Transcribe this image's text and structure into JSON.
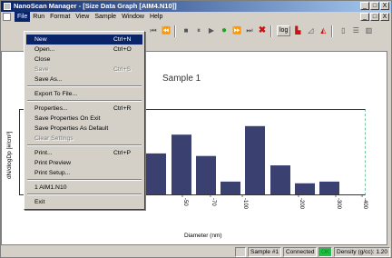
{
  "window": {
    "title": "NanoScan Manager - [Size Data Graph  [AIM4.N10]]",
    "minimize": "_",
    "maximize": "□",
    "close": "X"
  },
  "mdi": {
    "minimize": "_",
    "restore": "□",
    "close": "X"
  },
  "menubar": {
    "items": [
      "File",
      "Run",
      "Format",
      "View",
      "Sample",
      "Window",
      "Help"
    ]
  },
  "toolbar": {
    "log_label": "log"
  },
  "file_menu": {
    "items": [
      {
        "label": "New",
        "shortcut": "Ctrl+N"
      },
      {
        "label": "Open...",
        "shortcut": "Ctrl+O"
      },
      {
        "label": "Close",
        "shortcut": ""
      },
      {
        "label": "Save",
        "shortcut": "Ctrl+S"
      },
      {
        "label": "Save As...",
        "shortcut": ""
      },
      {
        "label": "Export To File...",
        "shortcut": ""
      },
      {
        "label": "Properties...",
        "shortcut": "Ctrl+R"
      },
      {
        "label": "Save Properties On Exit",
        "shortcut": ""
      },
      {
        "label": "Save Properties As Default",
        "shortcut": ""
      },
      {
        "label": "Clear Settings",
        "shortcut": ""
      },
      {
        "label": "Print...",
        "shortcut": "Ctrl+P"
      },
      {
        "label": "Print Preview",
        "shortcut": ""
      },
      {
        "label": "Print Setup...",
        "shortcut": ""
      },
      {
        "label": "1 AIM1.N10",
        "shortcut": ""
      },
      {
        "label": "Exit",
        "shortcut": ""
      }
    ]
  },
  "chart_data": {
    "type": "bar",
    "title": "Sample 1",
    "xlabel": "Diameter (nm)",
    "ylabel": "dN/dlogDp [#/cm³]",
    "tick_labels": [
      "50",
      "70",
      "100",
      "200",
      "300",
      "400"
    ],
    "values": [
      48,
      70,
      45,
      15,
      80,
      34,
      13,
      15
    ],
    "bar_color": "#3a4070",
    "grid": false
  },
  "status": {
    "sample": "Sample #1",
    "connection": "Connected",
    "ok": "OK",
    "density": "Density (g/cc): 1.20"
  }
}
